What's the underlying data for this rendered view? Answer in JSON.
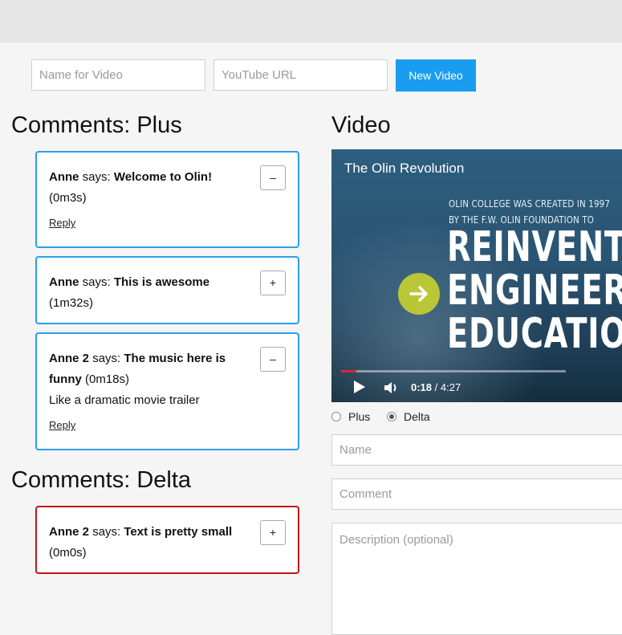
{
  "toolbar": {
    "name_placeholder": "Name for Video",
    "url_placeholder": "YouTube URL",
    "new_video_label": "New Video"
  },
  "plus": {
    "heading": "Comments: Plus",
    "comments": [
      {
        "author": "Anne",
        "says": "says:",
        "text": "Welcome to Olin!",
        "time": "(0m3s)",
        "extra": "",
        "vote": "–",
        "reply": "Reply"
      },
      {
        "author": "Anne",
        "says": "says:",
        "text": "This is awesome",
        "time": "(1m32s)",
        "extra": "",
        "vote": "+",
        "reply": ""
      },
      {
        "author": "Anne 2",
        "says": "says:",
        "text": "The music here is funny",
        "time": "(0m18s)",
        "extra": "Like a dramatic movie trailer",
        "vote": "–",
        "reply": "Reply"
      }
    ]
  },
  "delta": {
    "heading": "Comments: Delta",
    "comments": [
      {
        "author": "Anne 2",
        "says": "says:",
        "text": "Text is pretty small",
        "time": "(0m0s)",
        "vote": "+"
      }
    ]
  },
  "video": {
    "heading": "Video",
    "title": "The Olin Revolution",
    "line1": "OLIN COLLEGE WAS CREATED IN 1997",
    "line2": "BY THE F.W. OLIN FOUNDATION TO",
    "big1": "REINVENT",
    "big2": "ENGINEERI",
    "big3": "EDUCATION",
    "current_time": "0:18",
    "separator": " / ",
    "total_time": "4:27",
    "progress_fraction": 0.067,
    "buffered_fraction": 1.0,
    "accent_color": "#b9c635"
  },
  "form": {
    "radio_plus_label": "Plus",
    "radio_delta_label": "Delta",
    "selected": "Delta",
    "name_placeholder": "Name",
    "comment_placeholder": "Comment",
    "description_placeholder": "Description (optional)"
  }
}
